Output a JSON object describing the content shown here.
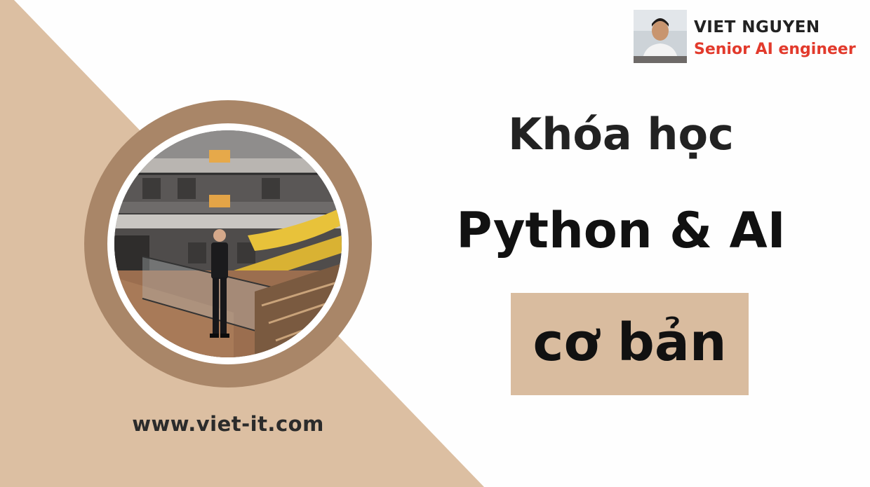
{
  "presenter": {
    "name": "VIET NGUYEN",
    "role": "Senior AI engineer"
  },
  "course": {
    "title_line_1": "Khóa học",
    "title_line_2": "Python & AI",
    "tag": "cơ bản"
  },
  "website": "www.viet-it.com",
  "colors": {
    "background": "#fefefe",
    "accent_beige": "#d9bc9f",
    "ring_brown": "#a98668",
    "role_red": "#e23a2c",
    "text_dark": "#222222"
  },
  "icons": {
    "presenter_avatar": "person-photo",
    "main_photo": "person-in-building-photo"
  }
}
